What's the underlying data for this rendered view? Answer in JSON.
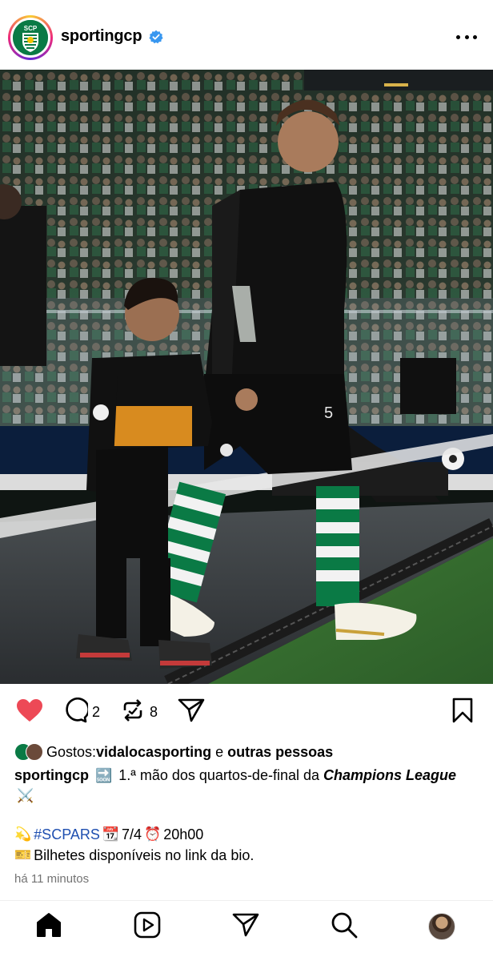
{
  "header": {
    "username": "sportingcp",
    "avatar_icon": "sporting-cp-crest-icon",
    "verified_icon": "verified-badge-icon",
    "more_icon": "more-options-icon"
  },
  "post": {
    "image_alt": "Jogador do Sporting CP a entrar em campo de mão dada com uma criança mascote"
  },
  "actions": {
    "like_icon": "heart-filled-icon",
    "comment_icon": "comment-icon",
    "comment_count": "2",
    "repost_icon": "repost-icon",
    "repost_count": "8",
    "share_icon": "send-icon",
    "save_icon": "bookmark-icon"
  },
  "likes": {
    "prefix": "Gostos: ",
    "user": "vidalocasporting",
    "conjunction": " e ",
    "others": "outras pessoas"
  },
  "caption": {
    "author": "sportingcp",
    "emoji_soon": "🔜",
    "text_main": " 1.ª mão dos quartos-de-final da ",
    "text_emph": "Champions League",
    "emoji_swords": "⚔️",
    "line3_emoji_start": "💫",
    "hashtag": "#SCPARS",
    "emoji_calendar": "📆",
    "date": "7/4",
    "emoji_clock": "⏰",
    "time": "20h00",
    "emoji_ticket": "🎫",
    "tickets_text": "Bilhetes disponíveis no link da bio."
  },
  "timestamp": "há 11 minutos",
  "nav": {
    "home_icon": "home-icon",
    "reels_icon": "reels-icon",
    "messages_icon": "send-icon",
    "search_icon": "search-icon",
    "profile_icon": "profile-avatar"
  },
  "colors": {
    "like": "#ed4956",
    "verified": "#3897f0",
    "hashtag": "#1f4fb0",
    "sporting_green": "#0a7a45"
  }
}
